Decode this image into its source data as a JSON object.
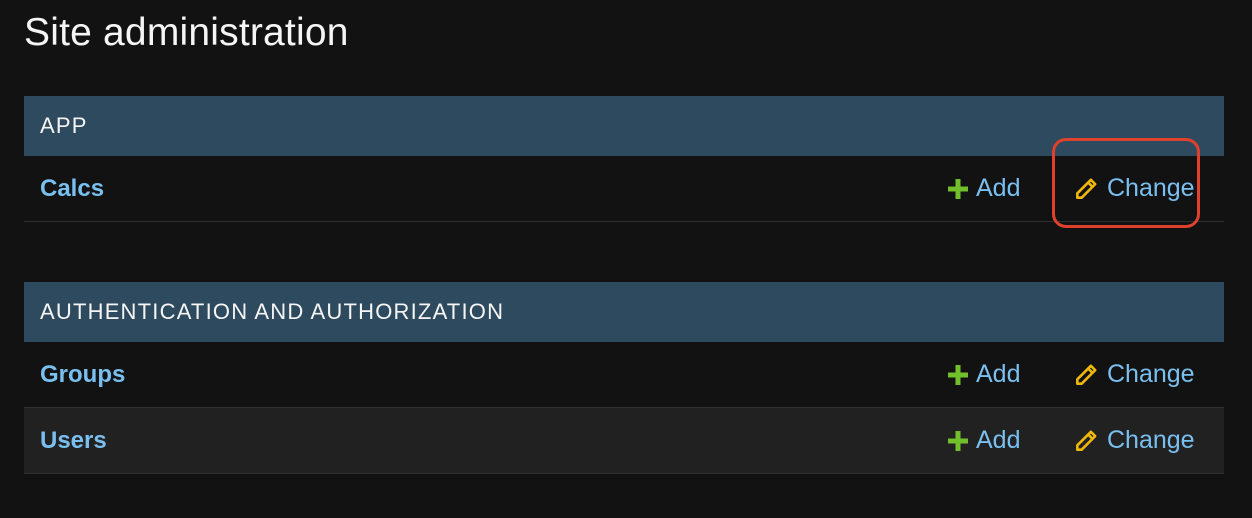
{
  "page": {
    "title": "Site administration"
  },
  "modules": [
    {
      "caption": "APP",
      "models": [
        {
          "name": "Calcs",
          "add_label": "Add",
          "change_label": "Change"
        }
      ]
    },
    {
      "caption": "AUTHENTICATION AND AUTHORIZATION",
      "models": [
        {
          "name": "Groups",
          "add_label": "Add",
          "change_label": "Change"
        },
        {
          "name": "Users",
          "add_label": "Add",
          "change_label": "Change"
        }
      ]
    }
  ],
  "icons": {
    "add": "plus-icon",
    "change": "pencil-icon"
  },
  "colors": {
    "background": "#121212",
    "header": "#2e4a5e",
    "link": "#79c0f0",
    "add_icon": "#70bf2b",
    "change_icon": "#efb80b",
    "highlight": "#e0412c"
  }
}
